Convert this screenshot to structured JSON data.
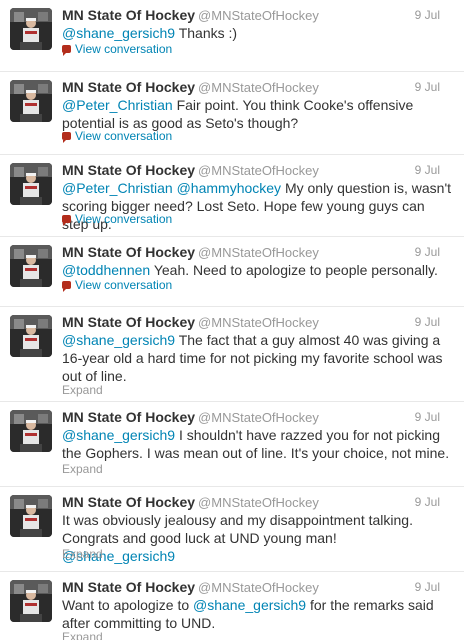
{
  "account": {
    "name": "MN State Of Hockey",
    "handle": "@MNStateOfHockey"
  },
  "colors": {
    "link": "#0084b4",
    "muted": "#999999",
    "text": "#333333",
    "icon": "#b32d1c"
  },
  "tweets": [
    {
      "time": "9 Jul",
      "parts": [
        {
          "m": "@shane_gersich9"
        },
        {
          "t": " Thanks :)"
        }
      ],
      "action": "View conversation",
      "action_icon": "conversation-bubble-icon"
    },
    {
      "time": "9 Jul",
      "parts": [
        {
          "m": "@Peter_Christian"
        },
        {
          "t": " Fair point. You think Cooke's offensive potential is as good as Seto's though?"
        }
      ],
      "action": "View conversation",
      "action_icon": "conversation-bubble-icon"
    },
    {
      "time": "9 Jul",
      "parts": [
        {
          "m": "@Peter_Christian"
        },
        {
          "t": " "
        },
        {
          "m": "@hammyhockey"
        },
        {
          "t": " My only question is, wasn't scoring bigger need?  Lost Seto. Hope few young guys can step up."
        }
      ],
      "action": "View conversation",
      "action_icon": "conversation-bubble-icon"
    },
    {
      "time": "9 Jul",
      "parts": [
        {
          "m": "@toddhennen"
        },
        {
          "t": " Yeah. Need to apologize to people personally."
        }
      ],
      "action": "View conversation",
      "action_icon": "conversation-bubble-icon"
    },
    {
      "time": "9 Jul",
      "parts": [
        {
          "m": "@shane_gersich9"
        },
        {
          "t": " The fact that a guy almost 40 was giving a 16-year old a hard time for not picking my favorite school was out of line."
        }
      ],
      "action": "Expand"
    },
    {
      "time": "9 Jul",
      "parts": [
        {
          "m": "@shane_gersich9"
        },
        {
          "t": " I shouldn't have razzed you for not picking the Gophers.  I was mean out of line.  It's your choice, not mine."
        }
      ],
      "action": "Expand"
    },
    {
      "time": "9 Jul",
      "parts": [
        {
          "t": "It was obviously jealousy and my disappointment talking.  Congrats and good luck at UND young man! "
        },
        {
          "m": "@shane_gersich9"
        }
      ],
      "action": "Expand"
    },
    {
      "time": "9 Jul",
      "parts": [
        {
          "t": "Want to apologize to "
        },
        {
          "m": "@shane_gersich9"
        },
        {
          "t": " for the remarks said after committing to UND."
        }
      ],
      "action": "Expand"
    }
  ]
}
